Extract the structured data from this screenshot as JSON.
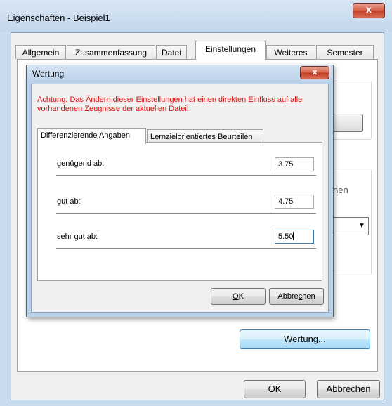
{
  "outer_dialog": {
    "title": "Eigenschaften - Beispiel1",
    "close_glyph": "x",
    "tabs": [
      {
        "label": "Allgemein"
      },
      {
        "label": "Zusammenfassung"
      },
      {
        "label": "Datei"
      },
      {
        "label": "Einstellungen"
      },
      {
        "label": "Weiteres"
      },
      {
        "label": "Semester"
      }
    ],
    "active_tab": "Einstellungen",
    "partial_text": "nen",
    "wertung_button": {
      "pre": "",
      "mnemonic": "W",
      "post": "ertung..."
    },
    "ok_button": {
      "pre": "",
      "mnemonic": "O",
      "post": "K"
    },
    "cancel_button": {
      "pre": "Abbre",
      "mnemonic": "c",
      "post": "hen"
    }
  },
  "inner_dialog": {
    "title": "Wertung",
    "close_glyph": "x",
    "warning_text": "Achtung: Das Ändern dieser Einstellungen hat einen direkten Einfluss auf alle vorhandenen Zeugnisse der aktuellen Datei!",
    "tabs": [
      {
        "label": "Differenzierende Angaben"
      },
      {
        "label": "Lernzielorientiertes Beurteilen"
      }
    ],
    "rows": [
      {
        "label": "genügend ab:",
        "value": "3.75"
      },
      {
        "label": "gut ab:",
        "value": "4.75"
      },
      {
        "label": "sehr gut ab:",
        "value": "5.50"
      }
    ],
    "ok_button": {
      "pre": "",
      "mnemonic": "O",
      "post": "K"
    },
    "cancel_button": {
      "pre": "Abbre",
      "mnemonic": "c",
      "post": "hen"
    }
  },
  "colors": {
    "warning": "#e01010",
    "close_button": "#c23e25",
    "title_bar": "#c3d7ec"
  }
}
